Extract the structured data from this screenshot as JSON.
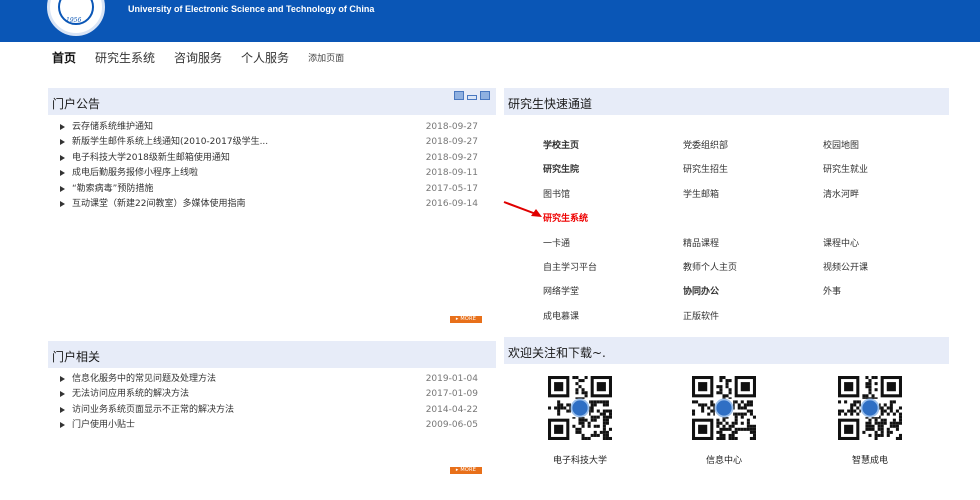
{
  "header": {
    "university_en": "University of Electronic Science and Technology of China",
    "logo_year": "1956",
    "bg_color": "#0a56b6"
  },
  "nav": {
    "items": [
      {
        "label": "首页",
        "active": true
      },
      {
        "label": "研究生系统"
      },
      {
        "label": "咨询服务"
      },
      {
        "label": "个人服务"
      }
    ],
    "add_page": "添加页面"
  },
  "announcements": {
    "title": "门户公告",
    "items": [
      {
        "title": "云存储系统维护通知",
        "date": "2018-09-27"
      },
      {
        "title": "新版学生邮件系统上线通知(2010-2017级学生...",
        "date": "2018-09-27"
      },
      {
        "title": "电子科技大学2018级新生邮箱使用通知",
        "date": "2018-09-27"
      },
      {
        "title": "成电后勤服务报修小程序上线啦",
        "date": "2018-09-11"
      },
      {
        "title": "“勒索病毒”预防措施",
        "date": "2017-05-17"
      },
      {
        "title": "互动课堂（新建22间教室）多媒体使用指南",
        "date": "2016-09-14"
      }
    ],
    "more": "MORE"
  },
  "related": {
    "title": "门户相关",
    "items": [
      {
        "title": "信息化服务中的常见问题及处理方法",
        "date": "2019-01-04"
      },
      {
        "title": "无法访问应用系统的解决方法",
        "date": "2017-01-09"
      },
      {
        "title": "访问业务系统页面显示不正常的解决方法",
        "date": "2014-04-22"
      },
      {
        "title": "门户使用小贴士",
        "date": "2009-06-05"
      }
    ],
    "more": "MORE"
  },
  "quick": {
    "title": "研究生快速通道",
    "links": [
      {
        "label": "学校主页",
        "style": "bold"
      },
      {
        "label": "党委组织部",
        "style": ""
      },
      {
        "label": "校园地图",
        "style": ""
      },
      {
        "label": "研究生院",
        "style": "bold"
      },
      {
        "label": "研究生招生",
        "style": ""
      },
      {
        "label": "研究生就业",
        "style": ""
      },
      {
        "label": "图书馆",
        "style": ""
      },
      {
        "label": "学生邮箱",
        "style": ""
      },
      {
        "label": "清水河畔",
        "style": ""
      },
      {
        "label": "研究生系统",
        "style": "red"
      },
      {
        "label": "",
        "style": ""
      },
      {
        "label": "",
        "style": ""
      },
      {
        "label": "一卡通",
        "style": ""
      },
      {
        "label": "精品课程",
        "style": ""
      },
      {
        "label": "课程中心",
        "style": ""
      },
      {
        "label": "自主学习平台",
        "style": ""
      },
      {
        "label": "教师个人主页",
        "style": ""
      },
      {
        "label": "视频公开课",
        "style": ""
      },
      {
        "label": "网络学堂",
        "style": ""
      },
      {
        "label": "协同办公",
        "style": "bold"
      },
      {
        "label": "外事",
        "style": ""
      },
      {
        "label": "成电慕课",
        "style": ""
      },
      {
        "label": "正版软件",
        "style": ""
      }
    ],
    "highlight_color": "#e00000"
  },
  "follow": {
    "title": "欢迎关注和下载~.",
    "qrcodes": [
      {
        "label": "电子科技大学"
      },
      {
        "label": "信息中心"
      },
      {
        "label": "智慧成电"
      }
    ]
  }
}
